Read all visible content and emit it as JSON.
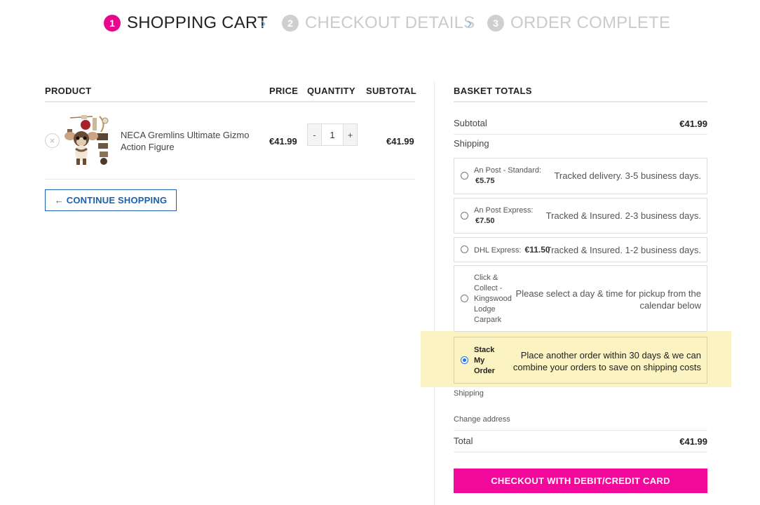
{
  "steps": [
    {
      "num": "1",
      "label": "SHOPPING CART",
      "active": true
    },
    {
      "num": "2",
      "label": "CHECKOUT DETAILS",
      "active": false
    },
    {
      "num": "3",
      "label": "ORDER COMPLETE",
      "active": false
    }
  ],
  "step_separator": "›",
  "cart": {
    "headers": {
      "product": "PRODUCT",
      "price": "PRICE",
      "quantity": "QUANTITY",
      "subtotal": "SUBTOTAL"
    },
    "items": [
      {
        "remove_symbol": "×",
        "name": "NECA Gremlins Ultimate Gizmo Action Figure",
        "price": "€41.99",
        "quantity": "1",
        "qty_minus": "-",
        "qty_plus": "+",
        "subtotal": "€41.99"
      }
    ],
    "continue_label": "← CONTINUE SHOPPING"
  },
  "totals": {
    "title": "BASKET TOTALS",
    "subtotal_label": "Subtotal",
    "subtotal_value": "€41.99",
    "shipping_label": "Shipping",
    "options": [
      {
        "name": "An Post - Standard:",
        "price": "€5.75",
        "desc": "Tracked delivery. 3-5 business days.",
        "selected": false
      },
      {
        "name": "An Post Express:",
        "price": "€7.50",
        "desc": "Tracked & Insured. 2-3 business days.",
        "selected": false
      },
      {
        "name": "DHL Express:",
        "price": "€11.50",
        "desc": "Tracked & Insured. 1-2 business days.",
        "selected": false
      },
      {
        "name_lines": [
          "Click &",
          "Collect -",
          "Kingswood",
          "Lodge",
          "Carpark"
        ],
        "desc_lines": [
          "Please select a day & time for pickup from the",
          "calendar below"
        ],
        "selected": false
      },
      {
        "name_lines": [
          "Stack",
          "My",
          "Order"
        ],
        "desc_lines": [
          "Place another order within 30 days & we can",
          "combine your orders to save on shipping costs"
        ],
        "selected": true
      }
    ],
    "shipping_note": "Shipping",
    "change_address": "Change address",
    "total_label": "Total",
    "total_value": "€41.99",
    "checkout_label": "CHECKOUT WITH DEBIT/CREDIT CARD"
  },
  "colors": {
    "accent": "#e8068f",
    "link": "#1e5fb0",
    "highlight": "#fbf3c2",
    "checkout": "#f2089a"
  }
}
